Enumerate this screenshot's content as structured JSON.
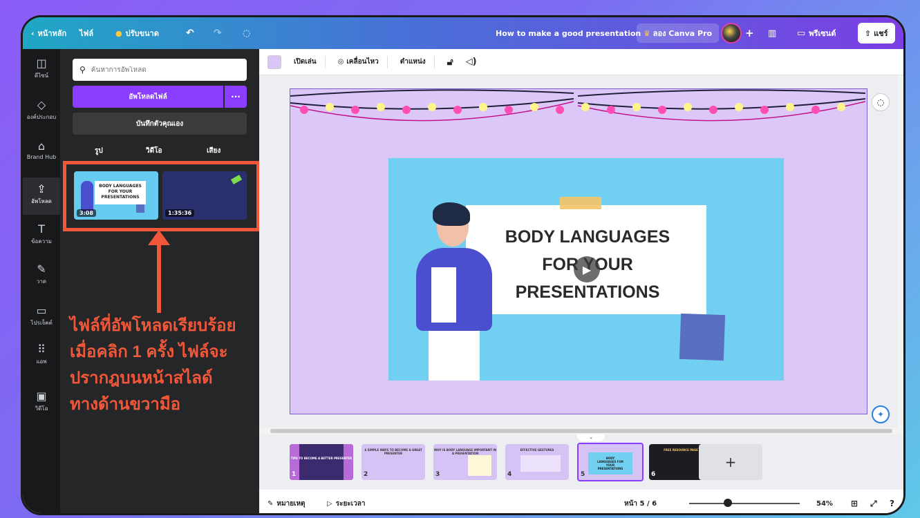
{
  "topbar": {
    "home": "หน้าหลัก",
    "file": "ไฟล์",
    "resize": "ปรับขนาด",
    "doc_title": "How to make a good presentation",
    "try_pro": "ลอง Canva Pro",
    "present": "พรีเซนต์",
    "share": "แชร์"
  },
  "rail": [
    {
      "icon": "layout-icon",
      "label": "ดีไซน์"
    },
    {
      "icon": "elements-icon",
      "label": "องค์ประกอบ"
    },
    {
      "icon": "brand-icon",
      "label": "Brand Hub"
    },
    {
      "icon": "upload-icon",
      "label": "อัพโหลด"
    },
    {
      "icon": "text-icon",
      "label": "ข้อความ"
    },
    {
      "icon": "draw-icon",
      "label": "วาด"
    },
    {
      "icon": "folder-icon",
      "label": "โปรเจ็คต์"
    },
    {
      "icon": "apps-icon",
      "label": "แอพ"
    },
    {
      "icon": "video-icon",
      "label": "วิดีโอ"
    }
  ],
  "panel": {
    "search_placeholder": "ค้นหาการอัพโหลด",
    "upload_button": "อัพโหลดไฟล์",
    "more_button": "···",
    "record_button": "บันทึกตัวคุณเอง",
    "tabs": [
      "รูป",
      "วิดีโอ",
      "เสียง"
    ],
    "uploads": [
      {
        "duration": "3:08",
        "caption": "BODY LANGUAGES FOR YOUR PRESENTATIONS"
      },
      {
        "duration": "1:35:36"
      }
    ]
  },
  "annotation": {
    "lines": [
      "ไฟล์ที่อัพโหลดเรียบร้อย",
      "เมื่อคลิก 1 ครั้ง ไฟล์จะ",
      "ปรากฎบนหน้าสไลด์",
      "ทางด้านขวามือ"
    ],
    "color": "#f2573a"
  },
  "toolbar": {
    "play": "เปิดเล่น",
    "animate": "เคลื่อนไหว",
    "position": "ตำแหน่ง"
  },
  "slide": {
    "video_title_lines": [
      "BODY LANGUAGES",
      "FOR YOUR",
      "PRESENTATIONS"
    ]
  },
  "pages": [
    {
      "num": "1",
      "title": "TIPS TO BECOME A BETTER PRESENTER"
    },
    {
      "num": "2",
      "title": "6 SIMPLE WAYS TO BECOME A GREAT PRESENTER"
    },
    {
      "num": "3",
      "title": "WHY IS BODY LANGUAGE IMPORTANT IN A PRESENTATION"
    },
    {
      "num": "4",
      "title": "EFFECTIVE GESTURES"
    },
    {
      "num": "5",
      "title": "BODY LANGUAGES FOR YOUR PRESENTATIONS"
    },
    {
      "num": "6",
      "title": "FREE RESOURCE PAGE"
    }
  ],
  "bottombar": {
    "notes": "หมายเหตุ",
    "timer": "ระยะเวลา",
    "page_indicator": "หน้า 5 / 6",
    "zoom": "54%"
  },
  "colors": {
    "accent": "#8b3dff",
    "slide_bg": "#dcc8f8",
    "video_bg": "#71d0f2"
  }
}
